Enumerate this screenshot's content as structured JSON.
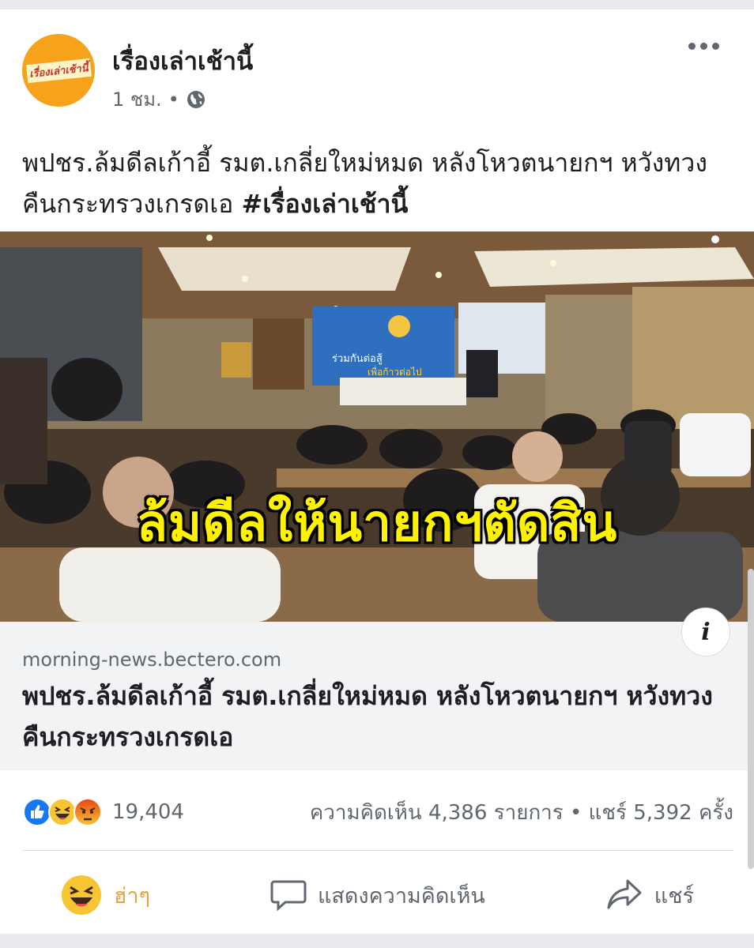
{
  "post": {
    "page_name": "เรื่องเล่าเช้านี้",
    "avatar_logo_text": "เรื่องเล่าเช้านี้",
    "time": "1 ชม.",
    "separator": "•",
    "caption_text": "พปชร.ล้มดีลเก้าอี้ รมต.เกลี่ยใหม่หมด หลังโหวตนายกฯ หวังทวงคืนกระทรวงเกรดเอ ",
    "caption_hashtag": "#เรื่องเล่าเช้านี้"
  },
  "photo": {
    "overlay_text": "ล้มดีลให้นายกฯตัดสิน",
    "backdrop_text_1": "ร่วมกันต่อสู้",
    "backdrop_text_2": "เพื่อก้าวต่อไป"
  },
  "link_preview": {
    "domain": "morning-news.bectero.com",
    "title": "พปชร.ล้มดีลเก้าอี้ รมต.เกลี่ยใหม่หมด หลังโหวตนายกฯ หวังทวงคืนกระทรวงเกรดเอ",
    "info_label": "i"
  },
  "stats": {
    "reaction_count": "19,404",
    "comments_and_shares": "ความคิดเห็น 4,386 รายการ • แชร์ 5,392 ครั้ง"
  },
  "actions": {
    "react_label": "ฮ่าๆ",
    "comment_label": "แสดงความคิดเห็น",
    "share_label": "แชร์"
  },
  "colors": {
    "avatar": "#f7a21b",
    "overlay_text": "#fff200",
    "haha_accent": "#e8a33b",
    "like_blue": "#1877f2",
    "angry_red": "#e9710f"
  }
}
